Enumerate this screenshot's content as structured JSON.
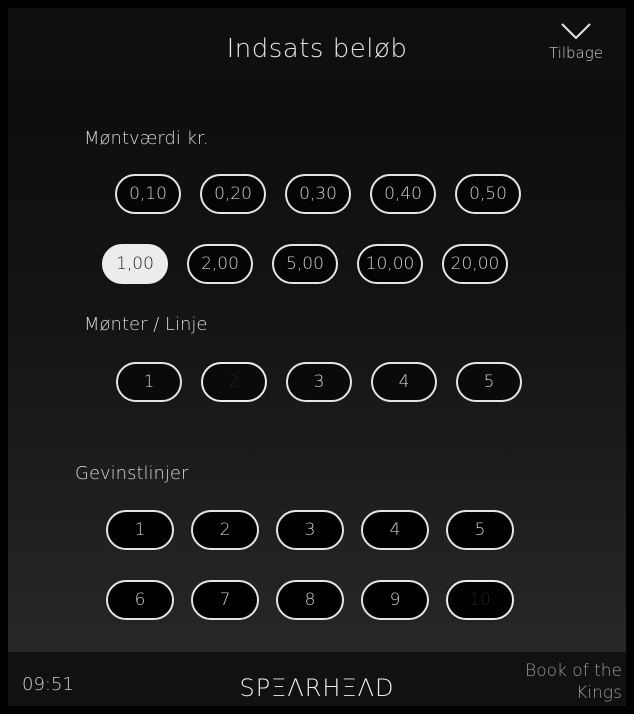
{
  "header": {
    "title": "Indsats beløb",
    "back_label": "Tilbage",
    "back_icon": "chevron-down-icon"
  },
  "coin_value": {
    "label": "Møntværdi kr.",
    "options": [
      "0,10",
      "0,20",
      "0,30",
      "0,40",
      "0,50",
      "1,00",
      "2,00",
      "5,00",
      "10,00",
      "20,00"
    ],
    "selected": "1,00"
  },
  "coins_per_line": {
    "label": "Mønter / Linje",
    "options": [
      "1",
      "2",
      "3",
      "4",
      "5"
    ],
    "selected": "2"
  },
  "paylines": {
    "label": "Gevinstlinjer",
    "options": [
      "1",
      "2",
      "3",
      "4",
      "5",
      "6",
      "7",
      "8",
      "9",
      "10"
    ],
    "selected": "10"
  },
  "footer": {
    "time": "09:51",
    "brand": "SPΞΛRHΞΛD",
    "game_title": "Book of the Kings"
  },
  "colors": {
    "selected_bg": "#ececec",
    "border": "#e5e5e5",
    "background": "#000000"
  }
}
